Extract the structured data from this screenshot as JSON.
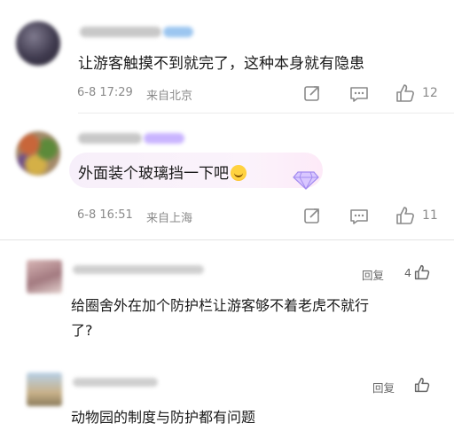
{
  "comments": [
    {
      "text": "让游客触摸不到就完了，这种本身就有隐患",
      "date": "6-8 17:29",
      "location": "来自北京",
      "likes": "12"
    },
    {
      "text": "外面装个玻璃挡一下吧",
      "date": "6-8 16:51",
      "location": "来自上海",
      "likes": "11"
    },
    {
      "text_line1": "给圈舍外在加个防护栏让游客够不着老虎不就行",
      "text_line2": "了?",
      "reply_label": "回复",
      "likes": "4"
    },
    {
      "text": "动物园的制度与防护都有问题",
      "reply_label": "回复"
    }
  ],
  "colors": {
    "meta_gray": "#8a8a8a",
    "divider": "#ececec",
    "bubble_purple": "#f7effa",
    "vip_badge": "#c9b4ff"
  },
  "icons": [
    "share-icon",
    "comment-icon",
    "thumbs-up-icon",
    "diamond-badge-icon"
  ]
}
